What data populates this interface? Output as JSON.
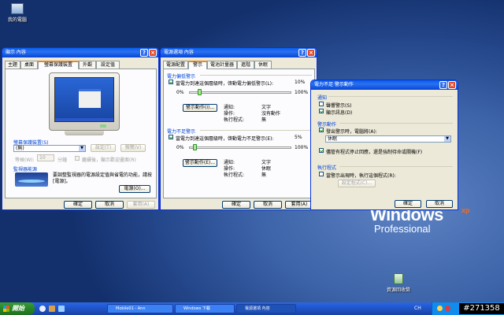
{
  "desktop": {
    "my_computer": "我的電腦",
    "recycle_bin": "資源回收筒"
  },
  "logo": {
    "windows": "Windows",
    "xp": "xp",
    "edition": "Professional"
  },
  "display_win": {
    "title": "顯示 內容",
    "tabs": [
      "主題",
      "桌面",
      "螢幕保護裝置",
      "外觀",
      "設定值"
    ],
    "screensaver_group": "螢幕保護裝置(S)",
    "screensaver_value": "(無)",
    "settings_btn": "設定(T)",
    "preview_btn": "預覽(V)",
    "wait_label": "等候(W):",
    "wait_value": "10",
    "minutes": "分鐘",
    "resume_label": "繼續後，顯示歡迎畫面(R)",
    "power_group": "監視器能源",
    "power_text": "要調整監視器的電源設定值與省電的功能，請按[電源]。",
    "power_btn": "電源(O)...",
    "ok": "確定",
    "cancel": "取消",
    "apply": "套用(A)"
  },
  "power_win": {
    "title": "電源選項 內容",
    "tabs": [
      "電源配置",
      "警示",
      "電池計量器",
      "進階",
      "休眠"
    ],
    "low_group": "電力偏低警示",
    "low_check": "當電力到達這個層級時，啓動電力偏低警示(L):",
    "low_pct": "10%",
    "critical_group": "電力不足警示",
    "critical_check": "當電力到達這個層級時，啓動電力不足警示(E):",
    "critical_pct": "5%",
    "scale_min": "0%",
    "scale_max": "100%",
    "low_level": 10,
    "critical_level": 5,
    "alarm_btn": "警示動作(I)...",
    "alarm_btn2": "警示動作(E)...",
    "lbl_notify": "通知:",
    "lbl_action": "操作:",
    "lbl_run": "執行程式:",
    "low_notify": "文字",
    "low_action": "沒有動作",
    "low_run": "無",
    "crit_notify": "文字",
    "crit_action": "休眠",
    "crit_run": "無",
    "ok": "確定",
    "cancel": "取消",
    "apply": "套用(A)"
  },
  "alarm_win": {
    "title": "電力不足 警示動作",
    "notify_group": "通知",
    "sound_alarm": "聲響警示(S)",
    "display_msg": "顯示訊息(D)",
    "action_group": "警示動作",
    "when_alarm": "發出警示時，電腦將(A):",
    "action_value": "休眠",
    "force_label": "儘管有程式停止回應，還是強制待命或關機(F)",
    "run_group": "執行程式",
    "run_check": "當警示出現時，執行這個程式(R):",
    "config_btn": "設定程式(C)...",
    "ok": "確定",
    "cancel": "取消"
  },
  "taskbar": {
    "start": "開始",
    "task1": "Mobile01 - Ann",
    "task2": "Windows 下載",
    "task3": "電源選項 內容",
    "lang": "CH",
    "watermark": "#271358"
  }
}
